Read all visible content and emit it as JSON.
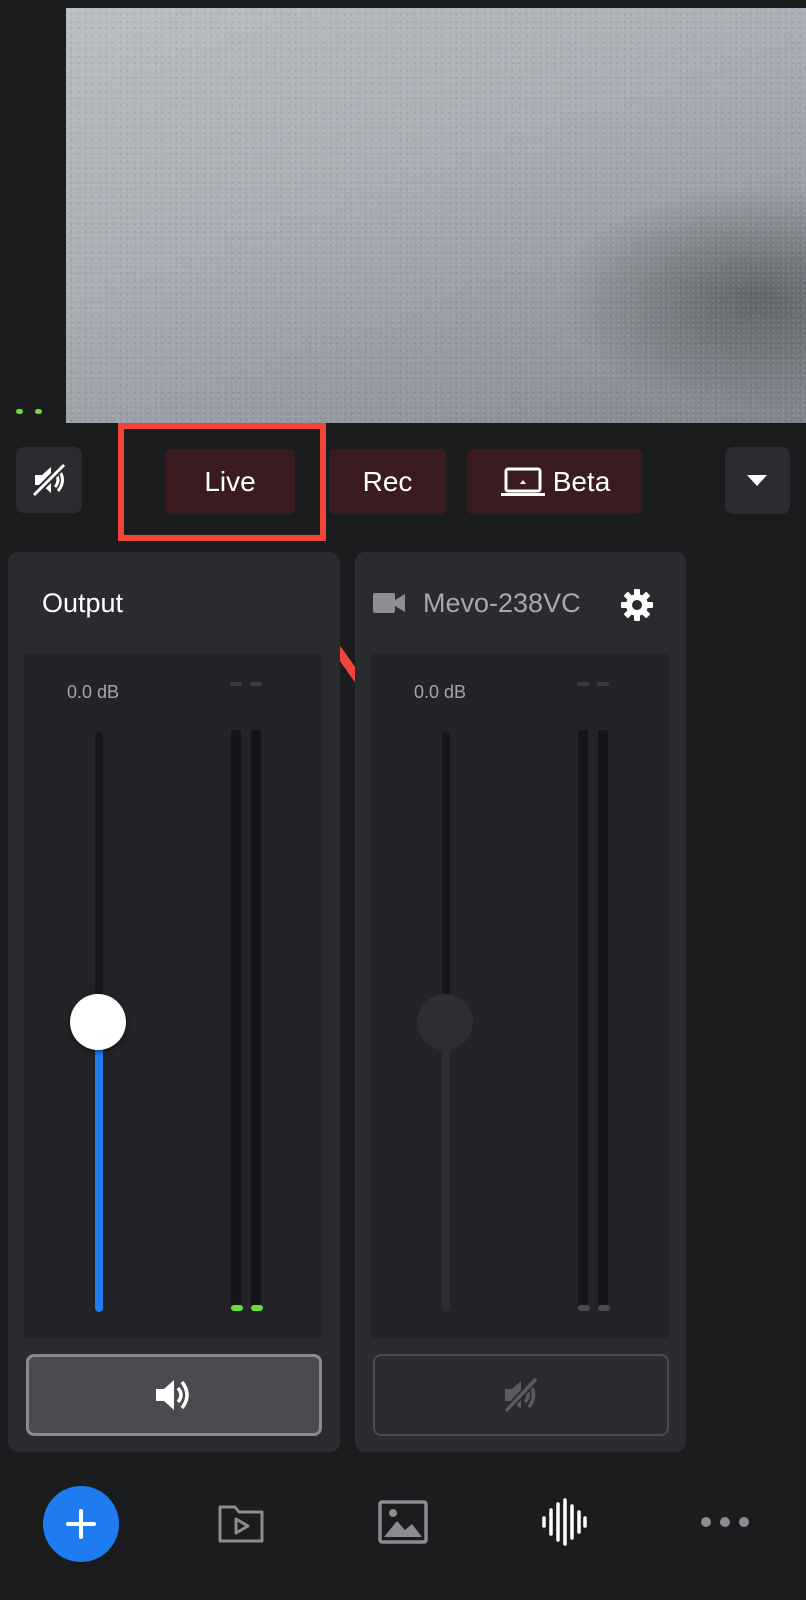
{
  "preview": {
    "name": "camera-preview"
  },
  "toolbar": {
    "live_label": "Live",
    "rec_label": "Rec",
    "beta_label": "Beta"
  },
  "panels": [
    {
      "title": "Output",
      "db": "0.0 dB",
      "fader_level": 0.5,
      "muted": false
    },
    {
      "title": "Mevo-238VC",
      "db": "0.0 dB",
      "fader_level": 0.5,
      "muted": true
    }
  ],
  "colors": {
    "accent_blue": "#1f7bf0",
    "live_bg": "#3a1c20",
    "highlight_red": "#f2443a",
    "meter_green": "#6bdc3a"
  },
  "icons": [
    "audio-muted-icon",
    "laptop-icon",
    "chevron-down-icon",
    "camera-icon",
    "gear-icon",
    "speaker-icon",
    "plus-icon",
    "folder-play-icon",
    "image-icon",
    "waveform-icon",
    "more-icon"
  ]
}
